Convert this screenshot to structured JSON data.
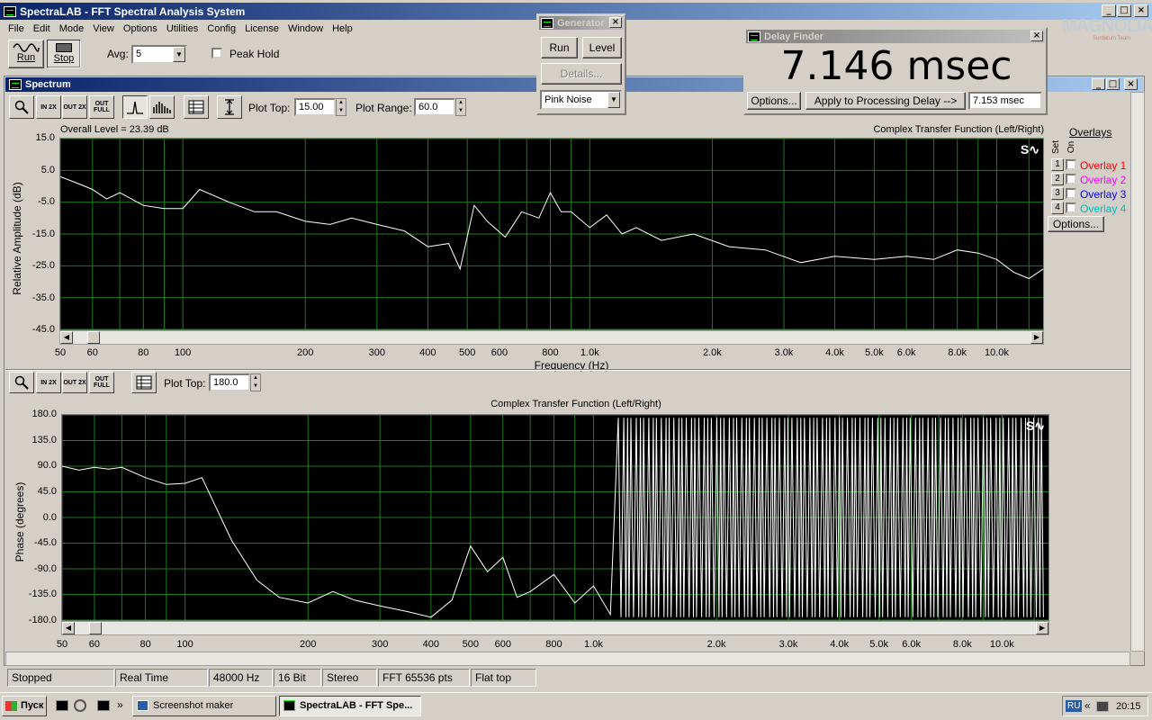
{
  "app": {
    "title": "SpectraLAB - FFT Spectral Analysis System"
  },
  "menu": [
    "File",
    "Edit",
    "Mode",
    "View",
    "Options",
    "Utilities",
    "Config",
    "License",
    "Window",
    "Help"
  ],
  "toolbar": {
    "run_label": "Run",
    "stop_label": "Stop",
    "avg_label": "Avg:",
    "avg_value": "5",
    "peak_hold_label": "Peak Hold"
  },
  "brand": {
    "logo_text": "MAGNOLIA",
    "logo_sub": "Surdatum Team"
  },
  "generator": {
    "title": "Generator",
    "run_label": "Run",
    "level_label": "Level",
    "details_label": "Details...",
    "signal_value": "Pink Noise"
  },
  "delay_finder": {
    "title": "Delay Finder",
    "value": "7.146 msec",
    "options_label": "Options...",
    "apply_label": "Apply to Processing Delay -->",
    "result_value": "7.153 msec"
  },
  "spectrum_window": {
    "title": "Spectrum"
  },
  "amplitude_toolbar": {
    "zoom_in_label": "IN 2X",
    "zoom_out_label": "OUT 2X",
    "zoom_full_label": "OUT FULL",
    "plot_top_label": "Plot Top:",
    "plot_top_value": "15.00",
    "plot_range_label": "Plot Range:",
    "plot_range_value": "60.0"
  },
  "phase_toolbar": {
    "plot_top_label": "Plot Top:",
    "plot_top_value": "180.0"
  },
  "amplitude_plot": {
    "overall_level": "Overall Level = 23.39 dB",
    "title": "Complex Transfer Function (Left/Right)",
    "ylabel": "Relative Amplitude (dB)",
    "xlabel": "Frequency (Hz)",
    "y_ticks": [
      "15.0",
      "5.0",
      "-5.0",
      "-15.0",
      "-25.0",
      "-35.0",
      "-45.0"
    ],
    "x_ticks": [
      "50",
      "60",
      "80",
      "100",
      "200",
      "300",
      "400",
      "500",
      "600",
      "800",
      "1.0k",
      "2.0k",
      "3.0k",
      "4.0k",
      "5.0k",
      "6.0k",
      "8.0k",
      "10.0k"
    ]
  },
  "phase_plot": {
    "title": "Complex Transfer Function (Left/Right)",
    "ylabel": "Phase (degrees)",
    "y_ticks": [
      "180.0",
      "135.0",
      "90.0",
      "45.0",
      "0.0",
      "-45.0",
      "-90.0",
      "-135.0",
      "-180.0"
    ],
    "x_ticks": [
      "50",
      "60",
      "80",
      "100",
      "200",
      "300",
      "400",
      "500",
      "600",
      "800",
      "1.0k",
      "2.0k",
      "3.0k",
      "4.0k",
      "5.0k",
      "6.0k",
      "8.0k",
      "10.0k"
    ]
  },
  "overlays": {
    "header": "Overlays",
    "set_label": "Set",
    "on_label": "On",
    "options_label": "Options...",
    "items": [
      {
        "num": "1",
        "label": "Overlay 1",
        "color": "#ff0000"
      },
      {
        "num": "2",
        "label": "Overlay 2",
        "color": "#ff00ff"
      },
      {
        "num": "3",
        "label": "Overlay 3",
        "color": "#0000ff"
      },
      {
        "num": "4",
        "label": "Overlay 4",
        "color": "#00c0c0"
      }
    ]
  },
  "status": [
    "Stopped",
    "Real Time",
    "48000 Hz",
    "16 Bit",
    "Stereo",
    "FFT 65536 pts",
    "Flat top"
  ],
  "taskbar": {
    "start_label": "Пуск",
    "item1": "Screenshot maker",
    "item2": "SpectraLAB - FFT Spe...",
    "lang": "RU",
    "clock": "20:15"
  },
  "chart_data": [
    {
      "type": "line",
      "title": "Complex Transfer Function (Left/Right)",
      "xlabel": "Frequency (Hz)",
      "ylabel": "Relative Amplitude (dB)",
      "x_scale": "log",
      "xlim": [
        50,
        13000
      ],
      "ylim": [
        -45,
        15
      ],
      "grid": true,
      "series": [
        {
          "x": [
            50,
            55,
            60,
            65,
            70,
            80,
            90,
            100,
            110,
            130,
            150,
            170,
            200,
            230,
            260,
            300,
            350,
            400,
            450,
            480,
            520,
            560,
            620,
            680,
            750,
            800,
            850,
            900,
            1000,
            1100,
            1200,
            1300,
            1500,
            1800,
            2200,
            2700,
            3300,
            4000,
            5000,
            6000,
            7000,
            8000,
            9000,
            10000,
            11000,
            12000,
            13000
          ],
          "y": [
            3,
            1,
            -1,
            -4,
            -2,
            -6,
            -7,
            -7,
            -1,
            -5,
            -8,
            -8,
            -11,
            -12,
            -10,
            -12,
            -14,
            -19,
            -18,
            -26,
            -6,
            -11,
            -16,
            -8,
            -10,
            -2,
            -8,
            -8,
            -13,
            -9,
            -15,
            -13,
            -17,
            -15,
            -19,
            -20,
            -24,
            -22,
            -23,
            -22,
            -23,
            -20,
            -21,
            -23,
            -27,
            -29,
            -26
          ]
        }
      ]
    },
    {
      "type": "line",
      "title": "Complex Transfer Function (Left/Right)",
      "ylabel": "Phase (degrees)",
      "x_scale": "log",
      "xlim": [
        50,
        13000
      ],
      "ylim": [
        -180,
        180
      ],
      "grid": true,
      "series": [
        {
          "x": [
            50,
            55,
            60,
            65,
            70,
            80,
            90,
            100,
            110,
            130,
            150,
            170,
            200,
            230,
            260,
            300,
            350,
            400,
            450,
            500,
            550,
            600,
            650,
            700,
            800,
            900,
            1000,
            1100
          ],
          "y": [
            90,
            83,
            88,
            85,
            88,
            70,
            58,
            60,
            70,
            -40,
            -110,
            -140,
            -150,
            -130,
            -145,
            -155,
            -165,
            -175,
            -145,
            -50,
            -95,
            -70,
            -140,
            -130,
            -100,
            -150,
            -120,
            -170
          ]
        }
      ]
    }
  ]
}
